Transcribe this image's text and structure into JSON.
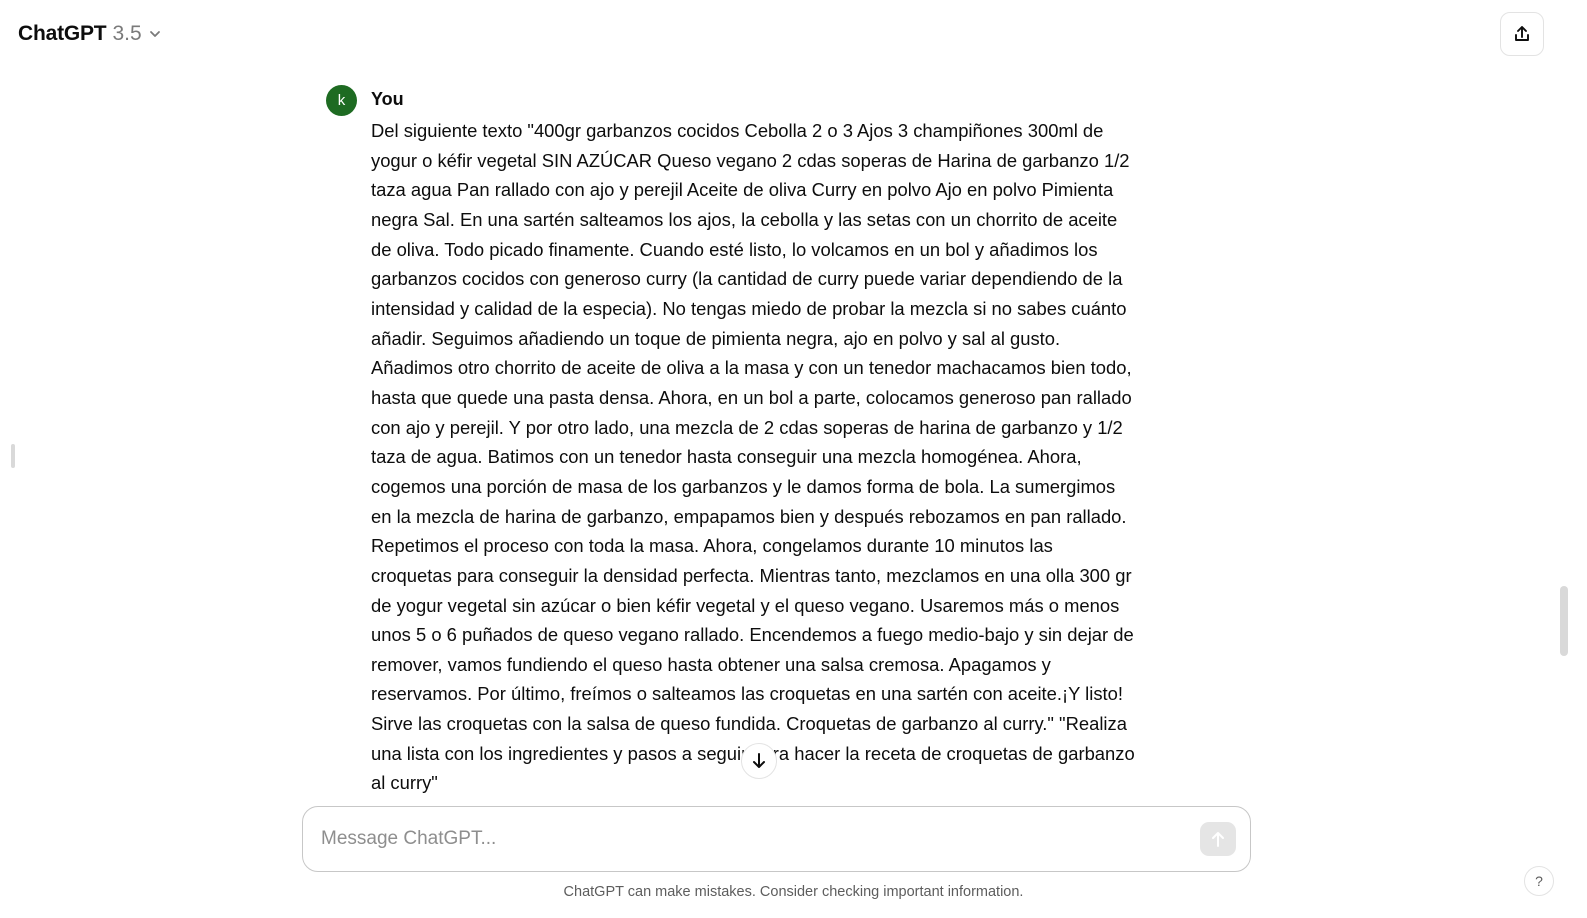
{
  "header": {
    "model_name": "ChatGPT",
    "model_version": "3.5",
    "model_chevron_icon": "chevron-down-icon",
    "share_icon": "share-upload-icon"
  },
  "conversation": {
    "messages": [
      {
        "avatar_letter": "k",
        "avatar_color": "#1e6b22",
        "author": "You",
        "text": "Del siguiente texto \"400gr garbanzos cocidos Cebolla 2 o 3 Ajos 3 champiñones 300ml de yogur o kéfir vegetal SIN AZÚCAR Queso vegano 2 cdas soperas de Harina de garbanzo 1/2 taza agua Pan rallado con ajo y perejil Aceite de oliva Curry en polvo Ajo en polvo Pimienta negra Sal. En una sartén salteamos los ajos, la cebolla y las setas con un chorrito de aceite de oliva. Todo picado finamente. Cuando esté listo, lo volcamos en un bol y añadimos los garbanzos cocidos con generoso curry (la cantidad de curry puede variar dependiendo de la intensidad y calidad de la especia). No tengas miedo de probar la mezcla si no sabes cuánto añadir. Seguimos añadiendo un toque de pimienta negra, ajo en polvo y sal al gusto. Añadimos otro chorrito de aceite de oliva a la masa y con un tenedor machacamos bien todo, hasta que quede una pasta densa. Ahora, en un bol a parte, colocamos generoso pan rallado con ajo y perejil. Y por otro lado, una mezcla de 2 cdas soperas de harina de garbanzo y 1/2 taza de agua. Batimos con un tenedor hasta conseguir una mezcla homogénea. Ahora, cogemos una porción de masa de los garbanzos y le damos forma de bola. La sumergimos en la mezcla de harina de garbanzo, empapamos bien y después rebozamos en pan rallado. Repetimos el proceso con toda la masa. Ahora, congelamos durante 10 minutos las croquetas para conseguir la densidad perfecta. Mientras tanto, mezclamos en una olla 300 gr de yogur vegetal sin azúcar o bien kéfir vegetal y el queso vegano. Usaremos más o menos unos 5 o 6 puñados de queso vegano rallado. Encendemos a fuego medio-bajo y sin dejar de remover, vamos fundiendo el queso hasta obtener una salsa cremosa. Apagamos y reservamos. Por último, freímos o salteamos las croquetas en una sartén con aceite.¡Y listo! Sirve las croquetas con la salsa de queso fundida. Croquetas de garbanzo al curry.\" \"Realiza una lista con los ingredientes y pasos a seguir para hacer la receta de croquetas de garbanzo al curry\""
      }
    ],
    "scroll_down_icon": "arrow-down-icon"
  },
  "composer": {
    "placeholder": "Message ChatGPT...",
    "value": "",
    "send_icon": "arrow-up-icon"
  },
  "footer": {
    "disclaimer": "ChatGPT can make mistakes. Consider checking important information.",
    "help_label": "?"
  },
  "colors": {
    "avatar": "#1e6b22",
    "send_button_disabled": "#e5e5e5",
    "border": "#c7c7c7"
  }
}
